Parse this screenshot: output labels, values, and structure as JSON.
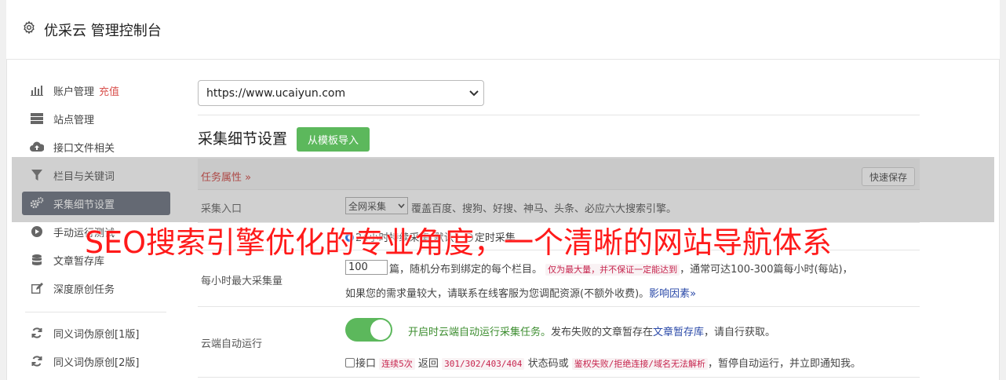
{
  "header": {
    "title": "优采云 管理控制台",
    "icon": "gear-icon"
  },
  "sidebar": {
    "items": [
      {
        "label": "账户管理",
        "accent": "充值",
        "icon": "bar-chart-icon"
      },
      {
        "label": "站点管理",
        "icon": "server-icon"
      },
      {
        "label": "接口文件相关",
        "icon": "cloud-upload-icon"
      },
      {
        "label": "栏目与关键词",
        "icon": "filter-icon"
      },
      {
        "label": "采集细节设置",
        "icon": "gears-icon",
        "active": true
      },
      {
        "label": "手动运行测试",
        "icon": "play-circle-icon"
      },
      {
        "label": "文章暂存库",
        "icon": "database-icon"
      },
      {
        "label": "深度原创任务",
        "icon": "edit-icon"
      },
      {
        "label": "同义词伪原创[1版]",
        "icon": "refresh-icon"
      },
      {
        "label": "同义词伪原创[2版]",
        "icon": "refresh-icon"
      }
    ]
  },
  "main": {
    "site_select": "https://www.ucaiyun.com",
    "section_title": "采集细节设置",
    "import_button": "从模板导入",
    "task_attr": "任务属性 »",
    "quick_save": "快速保存",
    "collect_entry": {
      "label": "采集入口",
      "select_value": "全网采集",
      "desc": "覆盖百度、搜狗、好搜、神马、头条、必应六大搜索引擎。"
    },
    "collect_time": {
      "option1": "24小时持续采集(默认)",
      "option2": "定时采集"
    },
    "max_per_hour": {
      "label": "每小时最大采集量",
      "value": "100",
      "text1": "篇，随机分布到绑定的每个栏目。",
      "code1": "仅为最大量，并不保证一定能达到",
      "text2": "，通常可达100-300篇每小时(每站)，",
      "text3": "如果您的需求量较大，请联系在线客服为您调配资源(不额外收费)。",
      "link": "影响因素»"
    },
    "cloud_run": {
      "label": "云端自动运行",
      "on_text": "开启时云端自动运行采集任务。",
      "text1": "发布失败的文章暂存在",
      "link": "文章暂存库",
      "text2": "，请自行获取。",
      "check_label": "接口",
      "code1": "连续5次",
      "text3": "返回",
      "code2": "301/302/403/404",
      "text4": "状态码或",
      "code3": "鉴权失败/拒绝连接/域名无法解析",
      "text5": "，暂停自动运行，并立即通知我。"
    }
  },
  "watermark": "SEO搜索引擎优化的专业角度，一个清晰的网站导航体系",
  "colors": {
    "active_bg": "#5a6270",
    "green": "#5cb85c",
    "red": "#d9534f",
    "watermark": "#ff1a1a"
  }
}
